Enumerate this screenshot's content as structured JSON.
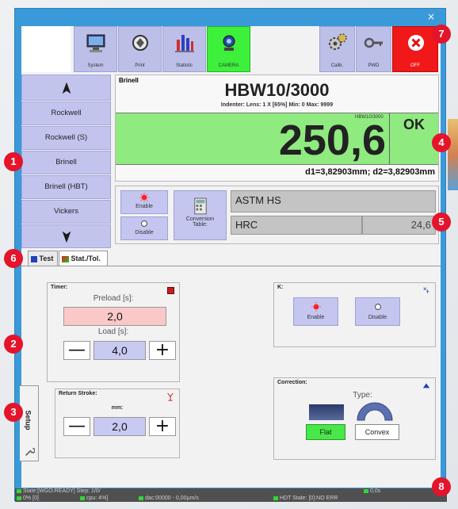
{
  "window": {
    "close_glyph": "×"
  },
  "toolbar": {
    "buttons": [
      {
        "label": "System",
        "icon": "computer-icon"
      },
      {
        "label": "Print",
        "icon": "printer-icon"
      },
      {
        "label": "Statistic",
        "icon": "bar-chart-icon"
      },
      {
        "label": "CAMERA",
        "icon": "camera-icon",
        "active": true
      }
    ],
    "right_buttons": [
      {
        "label": "Calib.",
        "icon": "gears-icon"
      },
      {
        "label": "PWD",
        "icon": "key-icon"
      },
      {
        "label": "OFF",
        "icon": "power-off-icon"
      }
    ]
  },
  "sidebar": {
    "items": [
      "Rockwell",
      "Rockwell (S)",
      "Brinell",
      "Brinell (HBT)",
      "Vickers"
    ]
  },
  "result": {
    "method": "Brinell",
    "scale": "HBW10/3000",
    "indenter_line": "Indenter:   Lens: 1 X [65%] Min: 0 Max: 9999",
    "small_scale": "HBW10/3000",
    "value": "250,6",
    "status": "OK",
    "diagonals": "d1=3,82903mm; d2=3,82903mm"
  },
  "conversion": {
    "enable_label": "Enable",
    "disable_label": "Disable",
    "table_label_1": "Conversion",
    "table_label_2": "Table:",
    "standard": "ASTM HS",
    "target_scale": "HRC",
    "target_value": "24,6"
  },
  "tabs": {
    "test": "Test",
    "stat": "Stat./Tol."
  },
  "setup": {
    "side_label": "Setup",
    "timer": {
      "title": "Timer:",
      "preload_label": "Preload [s]:",
      "preload_value": "2,0",
      "load_label": "Load [s]:",
      "load_value": "4,0",
      "minus": "—",
      "plus": "+"
    },
    "k": {
      "title": "K:",
      "enable_label": "Enable",
      "disable_label": "Disable"
    },
    "return_stroke": {
      "title": "Return Stroke:",
      "unit": "mm:",
      "value": "2,0",
      "minus": "—",
      "plus": "+"
    },
    "correction": {
      "title": "Correction:",
      "type_label": "Type:",
      "flat_label": "Flat",
      "convex_label": "Convex"
    }
  },
  "status_bar": {
    "state": "State:[WGO:READY] Step: 1/0/",
    "progress": "0% [0]",
    "cpu": "cpu: 4%]",
    "dac": "dac:00000 - 0,00µm/s",
    "hdt": "HDT State: [0]:NO ERR",
    "time": "0,0s"
  },
  "badges": [
    "1",
    "2",
    "3",
    "4",
    "5",
    "6",
    "7",
    "8"
  ],
  "colors": {
    "accent_green": "#8fea80",
    "button_purple": "#c2c4ee",
    "off_red": "#f01818",
    "badge_red": "#e4142b",
    "window_blue": "#3a9ad9"
  }
}
